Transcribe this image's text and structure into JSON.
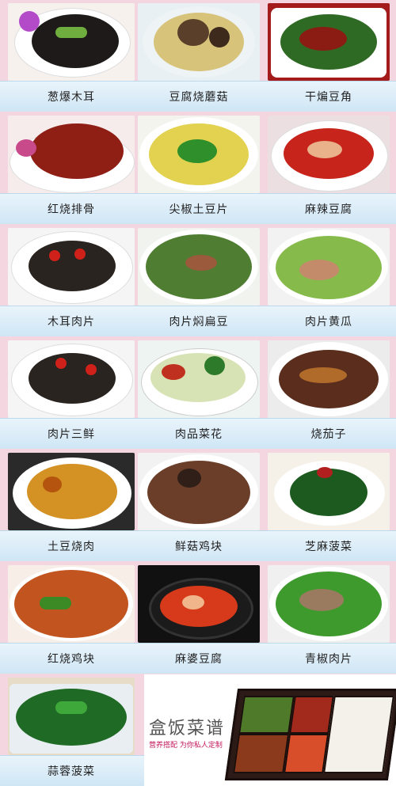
{
  "dishes": [
    {
      "name": "葱爆木耳"
    },
    {
      "name": "豆腐烧蘑菇"
    },
    {
      "name": "干煸豆角"
    },
    {
      "name": "红烧排骨"
    },
    {
      "name": "尖椒土豆片"
    },
    {
      "name": "麻辣豆腐"
    },
    {
      "name": "木耳肉片"
    },
    {
      "name": "肉片焖扁豆"
    },
    {
      "name": "肉片黄瓜"
    },
    {
      "name": "肉片三鲜"
    },
    {
      "name": "肉品菜花"
    },
    {
      "name": "烧茄子"
    },
    {
      "name": "土豆烧肉"
    },
    {
      "name": "鲜菇鸡块"
    },
    {
      "name": "芝麻菠菜"
    },
    {
      "name": "红烧鸡块"
    },
    {
      "name": "麻婆豆腐"
    },
    {
      "name": "青椒肉片"
    },
    {
      "name": "蒜蓉菠菜"
    }
  ],
  "promo": {
    "title": "盒饭菜谱",
    "subtitle": "营养搭配 为你私人定制"
  }
}
